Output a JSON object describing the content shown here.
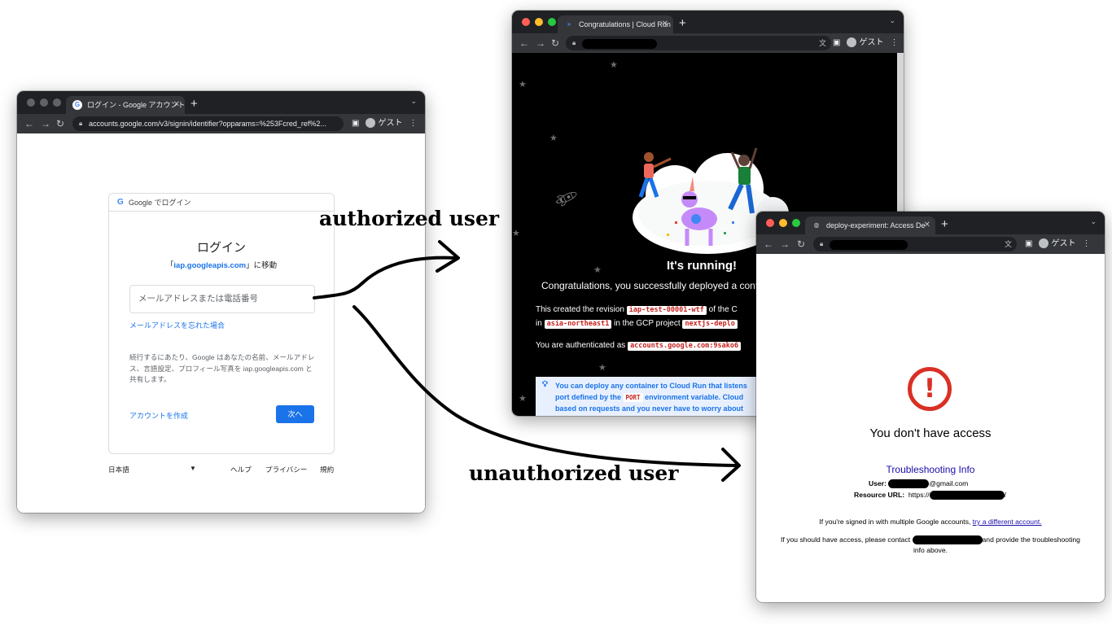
{
  "labels": {
    "authorized": "authorized user",
    "unauthorized": "unauthorized user"
  },
  "login_window": {
    "tab_title": "ログイン - Google アカウント",
    "url": "accounts.google.com/v3/signin/identifier?opparams=%253Fcred_ref%2...",
    "guest": "ゲスト",
    "card_header": "Google でログイン",
    "title": "ログイン",
    "subtitle_prefix": "「",
    "subtitle_domain": "iap.googleapis.com",
    "subtitle_suffix": "」に移動",
    "email_placeholder": "メールアドレスまたは電話番号",
    "forgot_email": "メールアドレスを忘れた場合",
    "consent_text": "続行するにあたり、Google はあなたの名前、メールアドレス、言語設定、プロフィール写真を iap.googleapis.com と共有します。",
    "create_account": "アカウントを作成",
    "next_button": "次へ",
    "footer_language": "日本語",
    "footer_help": "ヘルプ",
    "footer_privacy": "プライバシー",
    "footer_terms": "規約"
  },
  "cloudrun_window": {
    "tab_title": "Congratulations | Cloud Run",
    "guest": "ゲスト",
    "title": "It's running!",
    "subtitle": "Congratulations, you successfully deployed a cont",
    "revision_prefix": "This created the revision",
    "revision": "iap-test-00001-wtf",
    "revision_suffix": "of the C",
    "region_prefix": "in",
    "region": "asia-northeast1",
    "project_prefix": "in the GCP project",
    "project": "nextjs-deplo",
    "auth_prefix": "You are authenticated as",
    "auth_value": "accounts.google.com:9sako6",
    "tip_line1": "You can deploy any container to Cloud Run that listens",
    "tip_line2_prefix": "port defined by the",
    "tip_port": "PORT",
    "tip_line2_suffix": "environment variable. Cloud",
    "tip_line3": "based on requests and you never have to worry about"
  },
  "access_window": {
    "tab_title": "deploy-experiment: Access De",
    "guest": "ゲスト",
    "title": "You don't have access",
    "troubleshooting": "Troubleshooting Info",
    "user_label": "User:",
    "user_suffix": "@gmail.com",
    "resource_label": "Resource URL:",
    "resource_prefix": "https://",
    "resource_suffix": "/",
    "multi_prefix": "If you're signed in with multiple Google accounts,",
    "multi_link": "try a different account.",
    "contact_prefix": "If you should have access, please contact",
    "contact_suffix": "and provide the troubleshooting",
    "contact_line2": "info above."
  },
  "colors": {
    "chrome_dark": "#202124",
    "chrome_toolbar": "#35363a",
    "google_blue": "#1a73e8",
    "error_red": "#d93025"
  }
}
